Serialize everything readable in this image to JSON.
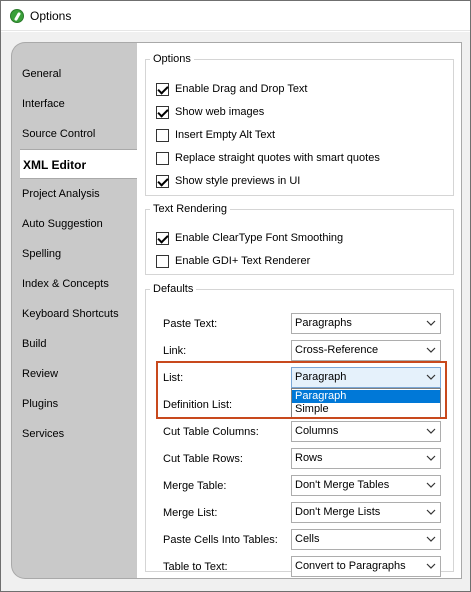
{
  "window": {
    "title": "Options"
  },
  "tabs": [
    "General",
    "Interface",
    "Source Control",
    "XML Editor",
    "Project Analysis",
    "Auto Suggestion",
    "Spelling",
    "Index & Concepts",
    "Keyboard Shortcuts",
    "Build",
    "Review",
    "Plugins",
    "Services"
  ],
  "active_tab": "XML Editor",
  "options_group": {
    "title": "Options",
    "items": [
      {
        "label": "Enable Drag and Drop Text",
        "checked": true
      },
      {
        "label": "Show web images",
        "checked": true
      },
      {
        "label": "Insert Empty Alt Text",
        "checked": false
      },
      {
        "label": "Replace straight quotes with smart quotes",
        "checked": false
      },
      {
        "label": "Show style previews in UI",
        "checked": true
      }
    ]
  },
  "text_rendering_group": {
    "title": "Text Rendering",
    "items": [
      {
        "label": "Enable ClearType Font Smoothing",
        "checked": true
      },
      {
        "label": "Enable GDI+ Text Renderer",
        "checked": false
      }
    ]
  },
  "defaults_group": {
    "title": "Defaults",
    "fields": [
      {
        "label": "Paste Text:",
        "value": "Paragraphs"
      },
      {
        "label": "Link:",
        "value": "Cross-Reference"
      },
      {
        "label": "List:",
        "value": "Paragraph"
      },
      {
        "label": "Definition List:",
        "value": ""
      },
      {
        "label": "Cut Table Columns:",
        "value": "Columns"
      },
      {
        "label": "Cut Table Rows:",
        "value": "Rows"
      },
      {
        "label": "Merge Table:",
        "value": "Don't Merge Tables"
      },
      {
        "label": "Merge List:",
        "value": "Don't Merge Lists"
      },
      {
        "label": "Paste Cells Into Tables:",
        "value": "Cells"
      },
      {
        "label": "Table to Text:",
        "value": "Convert to Paragraphs"
      }
    ],
    "open_dropdown": {
      "field": "List:",
      "options": [
        "Paragraph",
        "Simple"
      ],
      "selected": "Paragraph"
    }
  },
  "colors": {
    "highlight": "#c8491d",
    "selection": "#0078d7",
    "tab_pane": "#c9c9c9"
  }
}
